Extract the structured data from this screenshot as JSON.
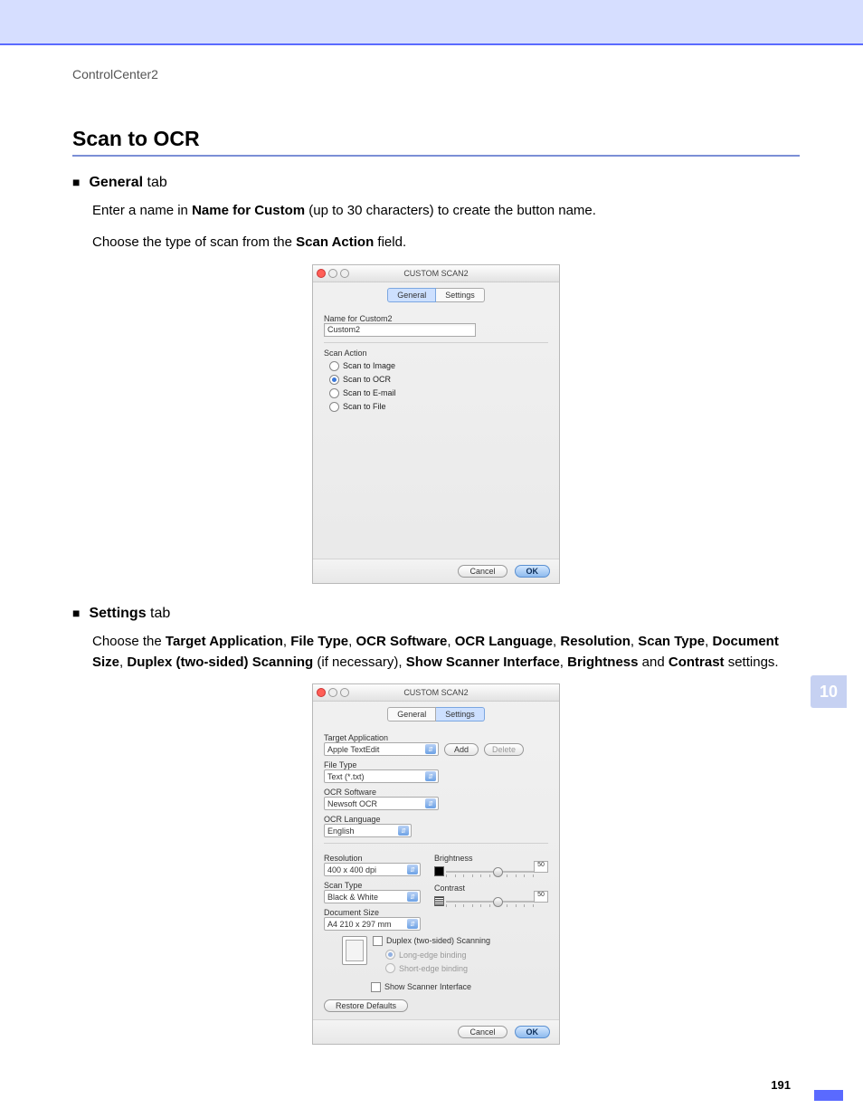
{
  "header": {
    "breadcrumb": "ControlCenter2"
  },
  "title": "Scan to OCR",
  "general": {
    "bullet_bold": "General",
    "bullet_rest": " tab",
    "line1_a": "Enter a name in ",
    "line1_b": "Name for Custom",
    "line1_c": " (up to 30 characters) to create the button name.",
    "line2_a": "Choose the type of scan from the ",
    "line2_b": "Scan Action",
    "line2_c": " field."
  },
  "settings": {
    "bullet_bold": "Settings",
    "bullet_rest": " tab",
    "para_parts": [
      "Choose the ",
      "Target Application",
      ", ",
      "File Type",
      ", ",
      "OCR Software",
      ", ",
      "OCR Language",
      ", ",
      "Resolution",
      ", ",
      "Scan Type",
      ", ",
      "Document Size",
      ", ",
      "Duplex (two-sided) Scanning",
      " (if necessary), ",
      "Show Scanner Interface",
      ", ",
      "Brightness",
      " and ",
      "Contrast",
      " settings."
    ]
  },
  "shot1": {
    "window_title": "CUSTOM SCAN2",
    "tabs": {
      "general": "General",
      "settings": "Settings"
    },
    "name_label": "Name for Custom2",
    "name_value": "Custom2",
    "scan_action_label": "Scan Action",
    "options": {
      "image": "Scan to Image",
      "ocr": "Scan to OCR",
      "email": "Scan to E-mail",
      "file": "Scan to File"
    },
    "buttons": {
      "cancel": "Cancel",
      "ok": "OK"
    }
  },
  "shot2": {
    "window_title": "CUSTOM SCAN2",
    "tabs": {
      "general": "General",
      "settings": "Settings"
    },
    "target_app_label": "Target Application",
    "target_app_value": "Apple TextEdit",
    "add_btn": "Add",
    "delete_btn": "Delete",
    "file_type_label": "File Type",
    "file_type_value": "Text (*.txt)",
    "ocr_software_label": "OCR Software",
    "ocr_software_value": "Newsoft OCR",
    "ocr_language_label": "OCR Language",
    "ocr_language_value": "English",
    "resolution_label": "Resolution",
    "resolution_value": "400 x 400 dpi",
    "scan_type_label": "Scan Type",
    "scan_type_value": "Black & White",
    "doc_size_label": "Document Size",
    "doc_size_value": "A4  210 x 297 mm",
    "brightness_label": "Brightness",
    "brightness_value": "50",
    "contrast_label": "Contrast",
    "contrast_value": "50",
    "duplex_label": "Duplex (two-sided) Scanning",
    "long_edge": "Long-edge binding",
    "short_edge": "Short-edge binding",
    "show_scanner": "Show Scanner Interface",
    "restore_defaults": "Restore Defaults",
    "buttons": {
      "cancel": "Cancel",
      "ok": "OK"
    }
  },
  "side_tab": "10",
  "page_number": "191"
}
